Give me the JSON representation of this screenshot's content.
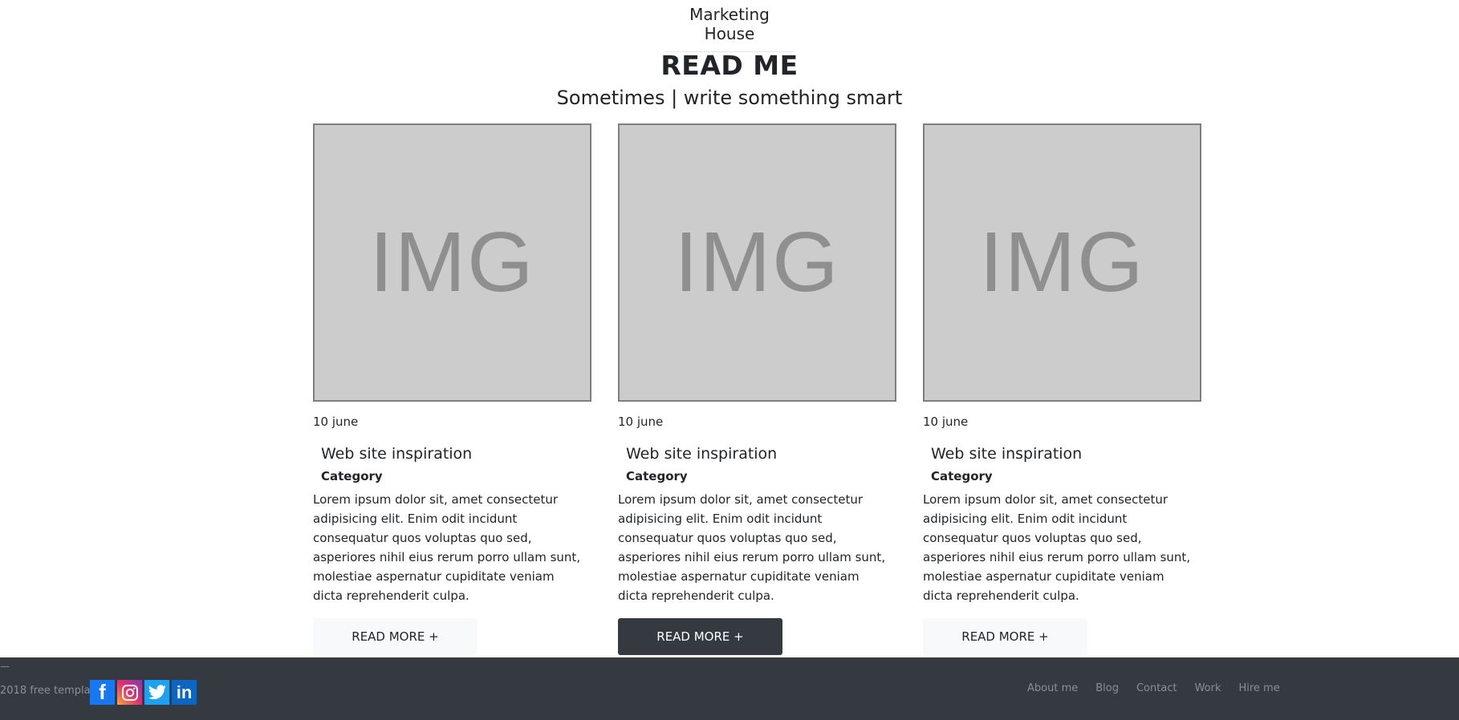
{
  "header": {
    "brand": "Marketing House"
  },
  "hero": {
    "title": "READ ME",
    "subtitle": "Sometimes | write something smart"
  },
  "cards": [
    {
      "image_text": "IMG",
      "date": "10 june",
      "title": "Web site inspiration",
      "category": "Category",
      "text": "Lorem ipsum dolor sit, amet consectetur adipisicing elit. Enim odit incidunt consequatur quos voluptas quo sed, asperiores nihil eius rerum porro ullam sunt, molestiae aspernatur cupiditate veniam dicta reprehenderit culpa.",
      "button": "READ MORE +"
    },
    {
      "image_text": "IMG",
      "date": "10 june",
      "title": "Web site inspiration",
      "category": "Category",
      "text": "Lorem ipsum dolor sit, amet consectetur adipisicing elit. Enim odit incidunt consequatur quos voluptas quo sed, asperiores nihil eius rerum porro ullam sunt, molestiae aspernatur cupiditate veniam dicta reprehenderit culpa.",
      "button": "READ MORE +"
    },
    {
      "image_text": "IMG",
      "date": "10 june",
      "title": "Web site inspiration",
      "category": "Category",
      "text": "Lorem ipsum dolor sit, amet consectetur adipisicing elit. Enim odit incidunt consequatur quos voluptas quo sed, asperiores nihil eius rerum porro ullam sunt, molestiae aspernatur cupiditate veniam dicta reprehenderit culpa.",
      "button": "READ MORE +"
    }
  ],
  "footer": {
    "dash": "—",
    "copyright": "2018 free templates",
    "social": [
      {
        "icon": "facebook-icon",
        "glyph": "f"
      },
      {
        "icon": "instagram-icon",
        "glyph": ""
      },
      {
        "icon": "twitter-icon",
        "glyph": ""
      },
      {
        "icon": "linkedin-icon",
        "glyph": "in"
      }
    ],
    "nav": [
      "About me",
      "Blog",
      "Contact",
      "Work",
      "Hire me"
    ]
  },
  "colors": {
    "dark": "#343a40",
    "light": "#f8f9fa",
    "placeholder": "#cccccc"
  }
}
